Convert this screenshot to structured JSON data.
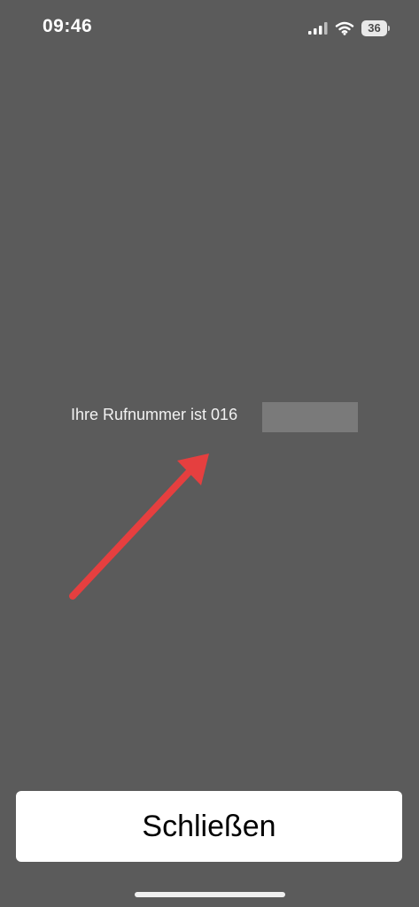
{
  "status_bar": {
    "time": "09:46",
    "battery_level": "36",
    "signal_strength": "3 of 4 bars",
    "wifi": "connected"
  },
  "message": {
    "text": "Ihre Rufnummer ist 016"
  },
  "actions": {
    "close_label": "Schließen"
  },
  "colors": {
    "background": "#5b5b5b",
    "button_background": "#ffffff",
    "button_text": "#000000",
    "arrow": "#e53f3f",
    "redaction": "#7a7a7a"
  },
  "icons": {
    "signal": "cellular-signal-icon",
    "wifi": "wifi-icon",
    "battery": "battery-icon",
    "arrow": "annotation-arrow-icon"
  }
}
